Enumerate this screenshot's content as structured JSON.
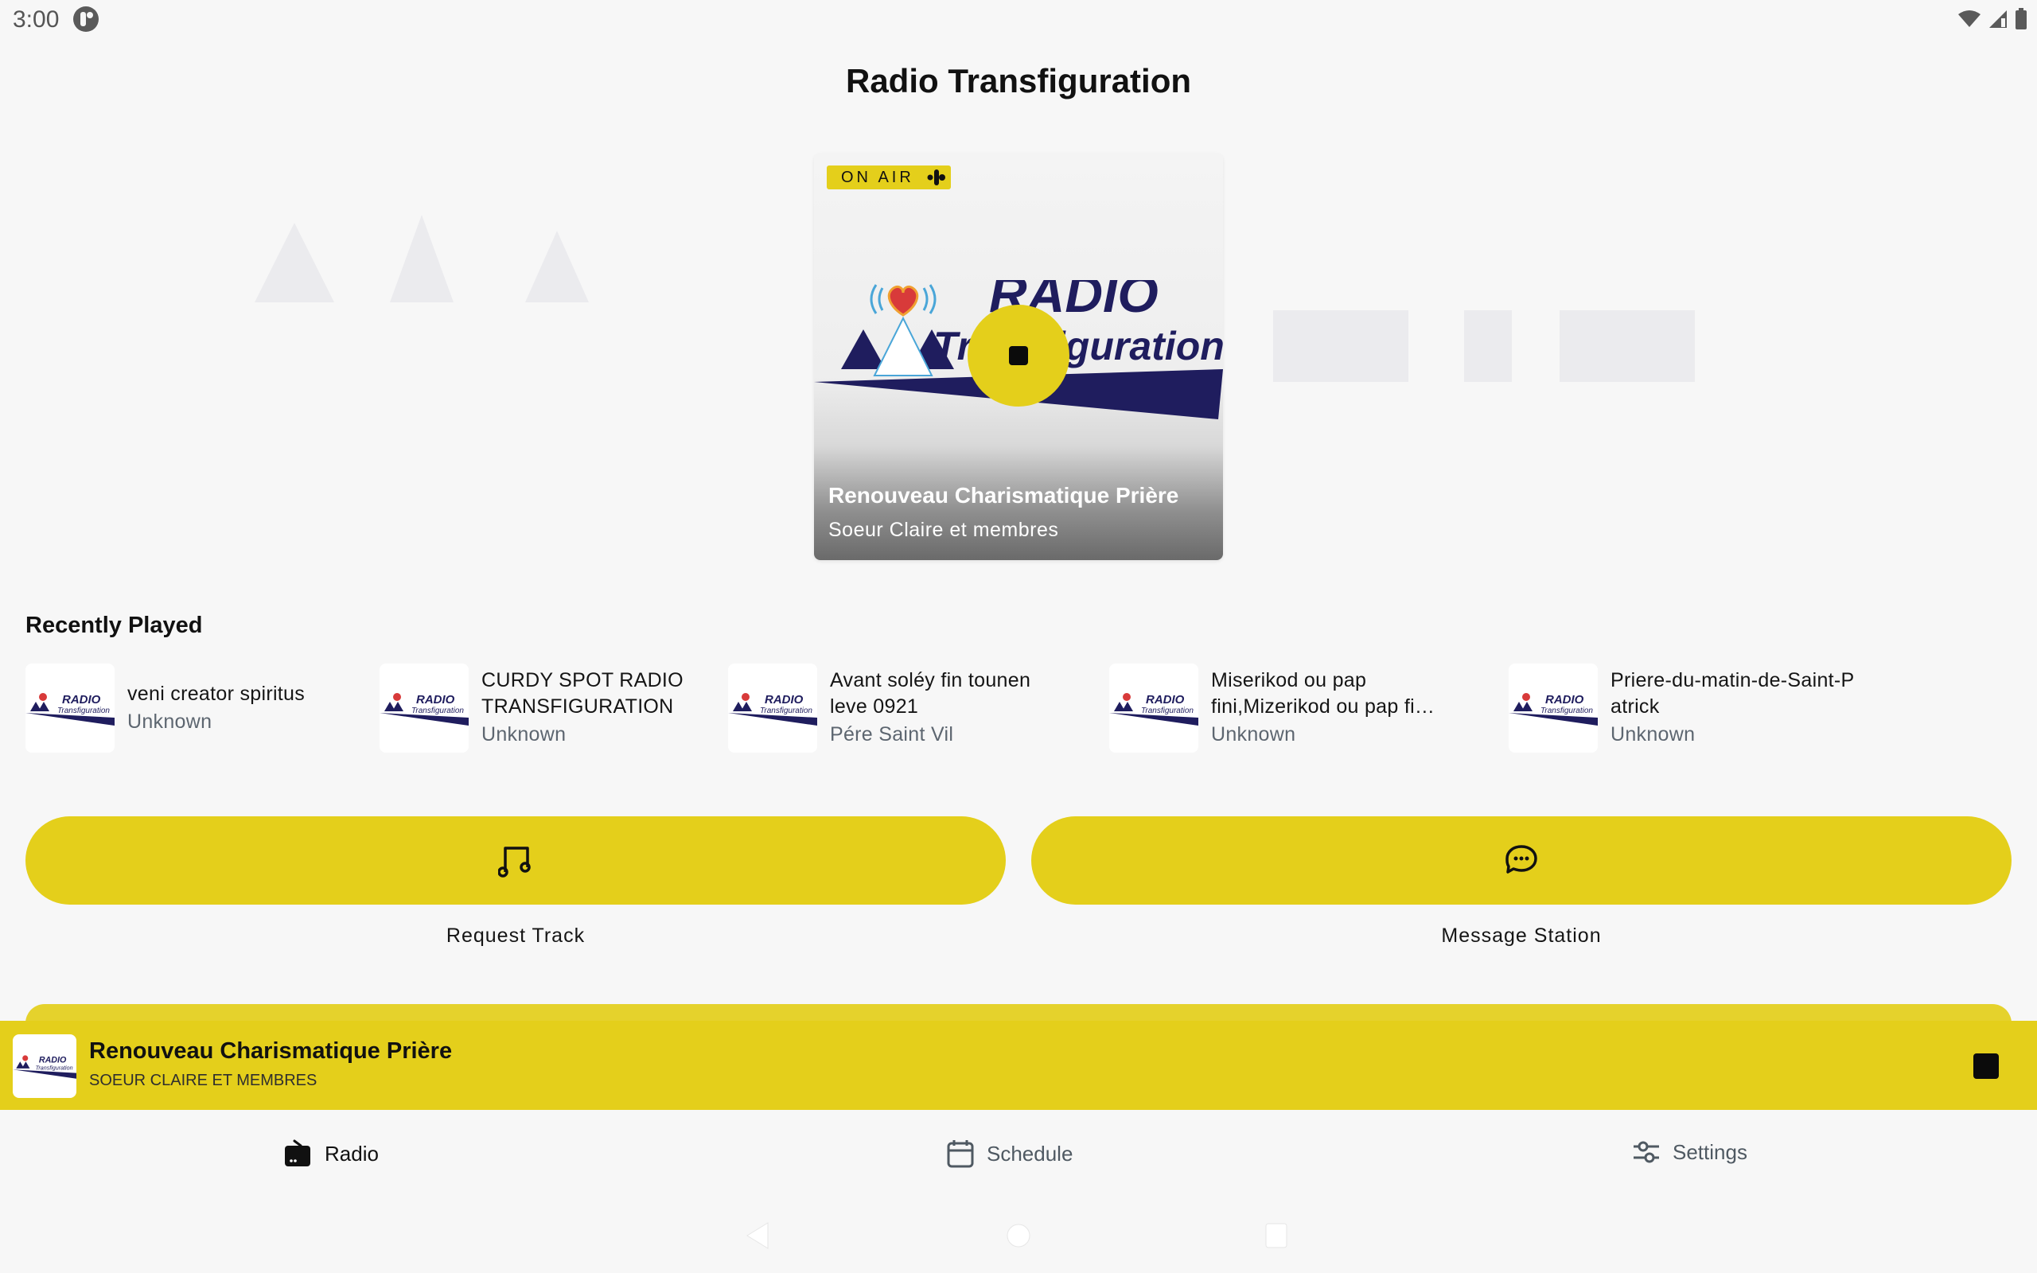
{
  "status_bar": {
    "time": "3:00",
    "app_icon": "notification-app-icon",
    "right_icons": [
      "wifi-icon",
      "cell-signal-icon",
      "battery-icon"
    ]
  },
  "header": {
    "title": "Radio Transfiguration"
  },
  "now_playing_card": {
    "badge": "ON AIR",
    "badge_icon": "live-audio-icon",
    "logo_text_top": "RADIO",
    "logo_text_bottom": "Transfiguration",
    "title": "Renouveau Charismatique Prière",
    "subtitle": "Soeur Claire et membres",
    "control_icon": "stop-icon"
  },
  "recently_played": {
    "title": "Recently Played",
    "items": [
      {
        "title": "veni creator spiritus",
        "artist": "Unknown"
      },
      {
        "title": "CURDY SPOT RADIO TRANSFIGURATION",
        "artist": "Unknown"
      },
      {
        "title": "Avant soléy fin tounen leve 0921",
        "artist": "Pére Saint Vil"
      },
      {
        "title": "Miserikod ou pap fini,Mizerikod ou pap fi…",
        "artist": "Unknown"
      },
      {
        "title": "Priere-du-matin-de-Saint-Patrick",
        "artist": "Unknown"
      }
    ]
  },
  "actions": {
    "request_track": "Request Track",
    "message_station": "Message Station"
  },
  "mini_player": {
    "title": "Renouveau Charismatique Prière",
    "subtitle": "SOEUR CLAIRE ET MEMBRES"
  },
  "bottom_nav": {
    "items": [
      {
        "label": "Radio",
        "icon": "radio-icon",
        "active": true
      },
      {
        "label": "Schedule",
        "icon": "calendar-icon",
        "active": false
      },
      {
        "label": "Settings",
        "icon": "sliders-icon",
        "active": false
      }
    ]
  },
  "colors": {
    "accent": "#e4cf1b",
    "background": "#f7f7f7",
    "logo_navy": "#1f1d5e",
    "muted_text": "#5d6670"
  }
}
